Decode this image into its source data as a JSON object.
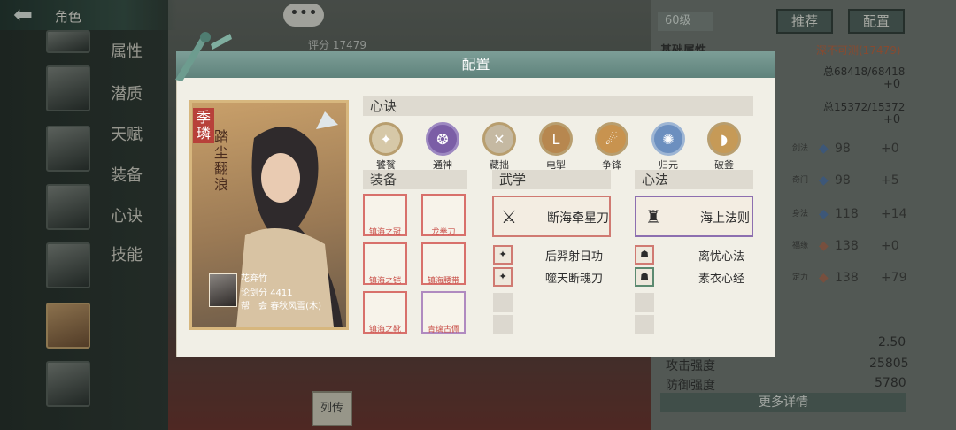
{
  "topbar": {
    "title": "角色",
    "back_icon": "arrow-left-icon"
  },
  "side_tabs": [
    "属性",
    "潜质",
    "天赋",
    "装备",
    "心诀",
    "技能"
  ],
  "chat_button": "•••",
  "score_label": "评分 17479",
  "level": "60级",
  "buttons": {
    "recommend": "推荐",
    "config": "配置"
  },
  "right_panel": {
    "basic_attr": "基础属性",
    "rank": "深不可测(17479)",
    "hp": "总68418/68418",
    "hp_delta": "+0",
    "mp": "总15372/15372",
    "mp_delta": "+0",
    "stats": [
      {
        "value": "98",
        "delta": "+0"
      },
      {
        "value": "98",
        "delta": "+5"
      },
      {
        "value": "118",
        "delta": "+14"
      },
      {
        "value": "138",
        "delta": "+0"
      },
      {
        "value": "138",
        "delta": "+79"
      }
    ],
    "stat_labels": [
      "剑法",
      "奇门",
      "身法",
      "福缘",
      "定力"
    ],
    "extra_value": "2.50",
    "attack_label": "攻击强度",
    "attack_value": "25805",
    "defense_label": "防御强度",
    "defense_value": "5780",
    "more_details": "更多详情"
  },
  "modal": {
    "title": "配置",
    "portrait": {
      "title_a": "季璘",
      "title_b": "踏尘翻浪",
      "name": "花弃竹",
      "score_label": "论剑分",
      "score": "4411",
      "guild_label": "帮　会",
      "guild": "春秋风雪(木)"
    },
    "xinjue": {
      "header": "心诀",
      "items": [
        {
          "label": "饕餮",
          "icon": "taotie-icon"
        },
        {
          "label": "通神",
          "icon": "tongshen-icon"
        },
        {
          "label": "藏拙",
          "icon": "cangzhuo-icon"
        },
        {
          "label": "电掣",
          "icon": "dianche-icon"
        },
        {
          "label": "争锋",
          "icon": "zhengfeng-icon"
        },
        {
          "label": "归元",
          "icon": "guiyuan-icon"
        },
        {
          "label": "破釜",
          "icon": "pofu-icon"
        }
      ]
    },
    "equipment": {
      "header": "装备",
      "items": [
        "镇海之冠",
        "龙拳刀",
        "镇海之铠",
        "镇海腰带",
        "镇海之靴",
        "青璃古佩"
      ]
    },
    "wuxue": {
      "header": "武学",
      "main": "断海牵星刀",
      "subs": [
        "后羿射日功",
        "噬天断魂刀"
      ]
    },
    "xinfa": {
      "header": "心法",
      "main": "海上法则",
      "subs": [
        "离忧心法",
        "素衣心经"
      ]
    }
  },
  "bottom": {
    "liezhuan": "列传"
  }
}
